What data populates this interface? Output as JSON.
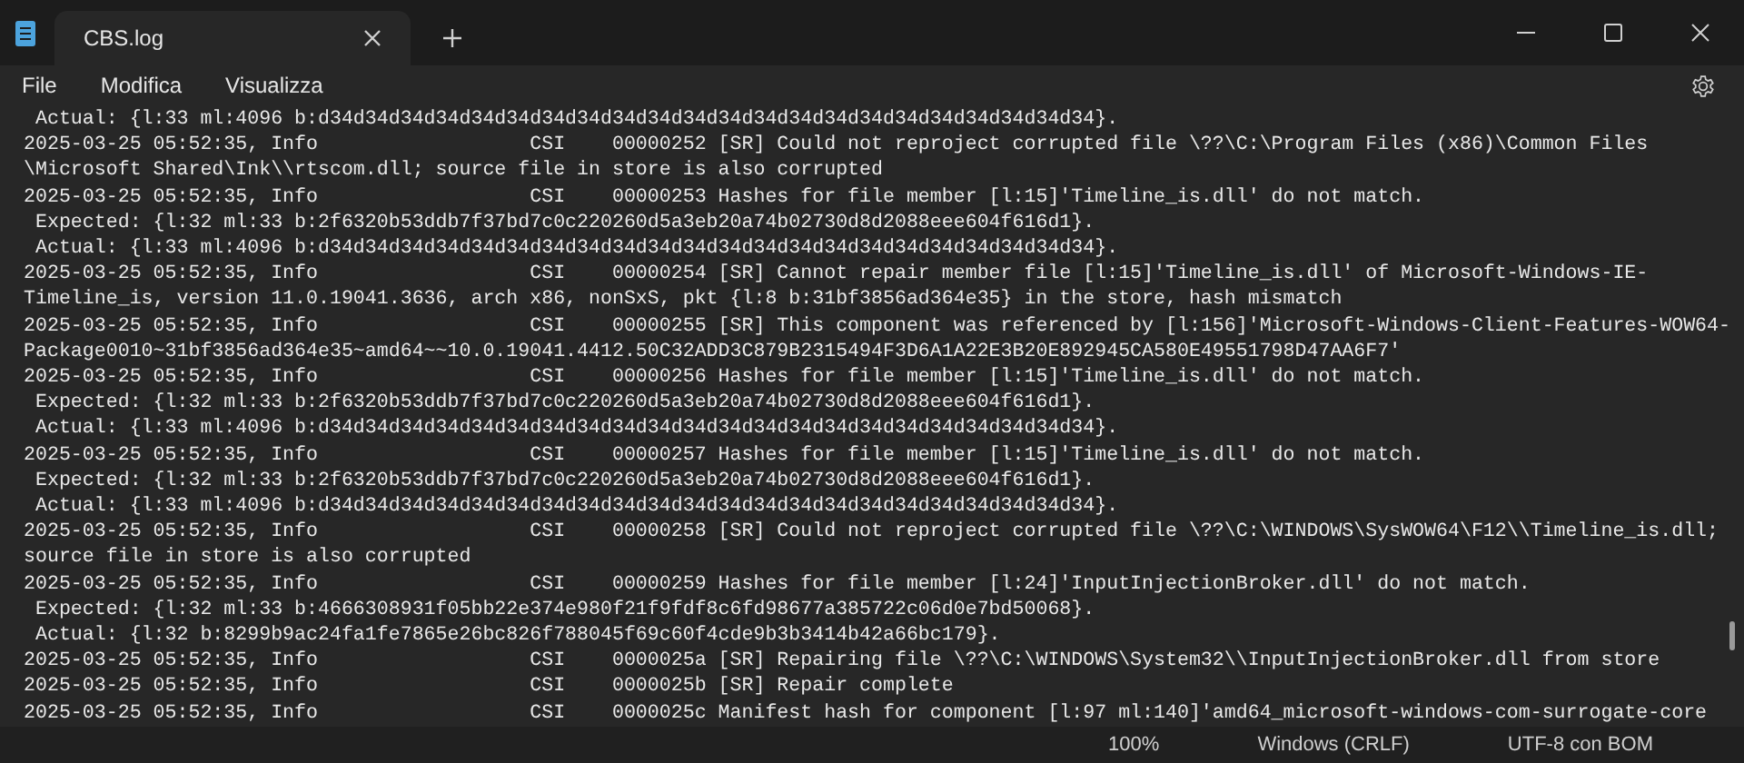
{
  "window": {
    "title": "CBS.log"
  },
  "menu": [
    "File",
    "Modifica",
    "Visualizza"
  ],
  "lines": [
    " Actual: {l:33 ml:4096 b:d34d34d34d34d34d34d34d34d34d34d34d34d34d34d34d34d34d34d34d34d34d34}.",
    "2025-03-25 05:52:35, Info                  CSI    00000252 [SR] Could not reproject corrupted file \\??\\C:\\Program Files (x86)\\Common Files",
    "\\Microsoft Shared\\Ink\\\\rtscom.dll; source file in store is also corrupted",
    "2025-03-25 05:52:35, Info                  CSI    00000253 Hashes for file member [l:15]'Timeline_is.dll' do not match.",
    " Expected: {l:32 ml:33 b:2f6320b53ddb7f37bd7c0c220260d5a3eb20a74b02730d8d2088eee604f616d1}.",
    " Actual: {l:33 ml:4096 b:d34d34d34d34d34d34d34d34d34d34d34d34d34d34d34d34d34d34d34d34d34d34}.",
    "2025-03-25 05:52:35, Info                  CSI    00000254 [SR] Cannot repair member file [l:15]'Timeline_is.dll' of Microsoft-Windows-IE-",
    "Timeline_is, version 11.0.19041.3636, arch x86, nonSxS, pkt {l:8 b:31bf3856ad364e35} in the store, hash mismatch",
    "2025-03-25 05:52:35, Info                  CSI    00000255 [SR] This component was referenced by [l:156]'Microsoft-Windows-Client-Features-WOW64-",
    "Package0010~31bf3856ad364e35~amd64~~10.0.19041.4412.50C32ADD3C879B2315494F3D6A1A22E3B20E892945CA580E49551798D47AA6F7'",
    "2025-03-25 05:52:35, Info                  CSI    00000256 Hashes for file member [l:15]'Timeline_is.dll' do not match.",
    " Expected: {l:32 ml:33 b:2f6320b53ddb7f37bd7c0c220260d5a3eb20a74b02730d8d2088eee604f616d1}.",
    " Actual: {l:33 ml:4096 b:d34d34d34d34d34d34d34d34d34d34d34d34d34d34d34d34d34d34d34d34d34d34}.",
    "2025-03-25 05:52:35, Info                  CSI    00000257 Hashes for file member [l:15]'Timeline_is.dll' do not match.",
    " Expected: {l:32 ml:33 b:2f6320b53ddb7f37bd7c0c220260d5a3eb20a74b02730d8d2088eee604f616d1}.",
    " Actual: {l:33 ml:4096 b:d34d34d34d34d34d34d34d34d34d34d34d34d34d34d34d34d34d34d34d34d34d34}.",
    "2025-03-25 05:52:35, Info                  CSI    00000258 [SR] Could not reproject corrupted file \\??\\C:\\WINDOWS\\SysWOW64\\F12\\\\Timeline_is.dll;",
    "source file in store is also corrupted",
    "2025-03-25 05:52:35, Info                  CSI    00000259 Hashes for file member [l:24]'InputInjectionBroker.dll' do not match.",
    " Expected: {l:32 ml:33 b:4666308931f05bb22e374e980f21f9fdf8c6fd98677a385722c06d0e7bd50068}.",
    " Actual: {l:32 b:8299b9ac24fa1fe7865e26bc826f788045f69c60f4cde9b3b3414b42a66bc179}.",
    "2025-03-25 05:52:35, Info                  CSI    0000025a [SR] Repairing file \\??\\C:\\WINDOWS\\System32\\\\InputInjectionBroker.dll from store",
    "2025-03-25 05:52:35, Info                  CSI    0000025b [SR] Repair complete",
    "2025-03-25 05:52:35, Info                  CSI    0000025c Manifest hash for component [l:97 ml:140]'amd64_microsoft-windows-com-surrogate-core"
  ],
  "status_bar": [
    "100%",
    "Windows (CRLF)",
    "UTF-8 con BOM"
  ]
}
